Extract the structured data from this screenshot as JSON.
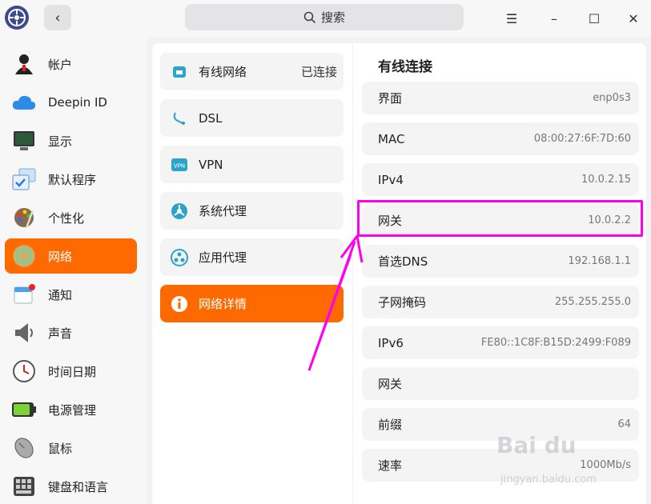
{
  "titlebar": {
    "search_label": "搜索",
    "menu_glyph": "☰",
    "minimize_glyph": "–",
    "maximize_glyph": "☐",
    "close_glyph": "✕"
  },
  "sidebar": {
    "items": [
      {
        "label": "帐户",
        "icon": "account-icon"
      },
      {
        "label": "Deepin ID",
        "icon": "cloud-icon"
      },
      {
        "label": "显示",
        "icon": "display-icon"
      },
      {
        "label": "默认程序",
        "icon": "default-apps-icon"
      },
      {
        "label": "个性化",
        "icon": "palette-icon"
      },
      {
        "label": "网络",
        "icon": "network-globe-icon",
        "active": true
      },
      {
        "label": "通知",
        "icon": "notification-icon"
      },
      {
        "label": "声音",
        "icon": "speaker-icon"
      },
      {
        "label": "时间日期",
        "icon": "clock-icon"
      },
      {
        "label": "电源管理",
        "icon": "battery-icon"
      },
      {
        "label": "鼠标",
        "icon": "mouse-icon"
      },
      {
        "label": "键盘和语言",
        "icon": "keyboard-icon"
      }
    ]
  },
  "network_menu": {
    "items": [
      {
        "label": "有线网络",
        "status": "已连接",
        "icon": "wired-icon"
      },
      {
        "label": "DSL",
        "status": "",
        "icon": "dsl-icon"
      },
      {
        "label": "VPN",
        "status": "",
        "icon": "vpn-icon"
      },
      {
        "label": "系统代理",
        "status": "",
        "icon": "system-proxy-icon"
      },
      {
        "label": "应用代理",
        "status": "",
        "icon": "app-proxy-icon"
      },
      {
        "label": "网络详情",
        "status": "",
        "icon": "info-icon",
        "active": true
      }
    ]
  },
  "details": {
    "title": "有线连接",
    "rows": [
      {
        "label": "界面",
        "value": "enp0s3"
      },
      {
        "label": "MAC",
        "value": "08:00:27:6F:7D:60"
      },
      {
        "label": "IPv4",
        "value": "10.0.2.15"
      },
      {
        "label": "网关",
        "value": "10.0.2.2"
      },
      {
        "label": "首选DNS",
        "value": "192.168.1.1"
      },
      {
        "label": "子网掩码",
        "value": "255.255.255.0"
      },
      {
        "label": "IPv6",
        "value": "FE80::1C8F:B15D:2499:F089"
      },
      {
        "label": "网关",
        "value": ""
      },
      {
        "label": "前缀",
        "value": "64"
      },
      {
        "label": "速率",
        "value": "1000Mb/s"
      }
    ]
  },
  "watermark": {
    "text": "Bai du",
    "sub": "jingyan.baidu.com"
  },
  "colors": {
    "accent": "#ff6a00",
    "annotation": "#ff00ee"
  }
}
